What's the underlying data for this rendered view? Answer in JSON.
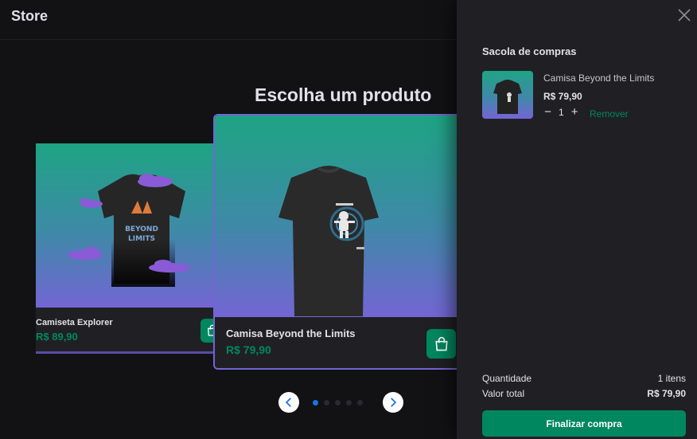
{
  "header": {
    "brand": "Store"
  },
  "main": {
    "title": "Escolha um produto"
  },
  "products": [
    {
      "name": "Camiseta Explorer",
      "price": "R$ 89,90"
    },
    {
      "name": "Camisa Beyond the Limits",
      "price": "R$ 79,90"
    }
  ],
  "carousel": {
    "dot_count": 5,
    "active_index": 0,
    "prev_icon": "chevron-left-icon",
    "next_icon": "chevron-right-icon"
  },
  "cart": {
    "title": "Sacola de compras",
    "item": {
      "name": "Camisa Beyond the Limits",
      "price": "R$ 79,90",
      "quantity": "1",
      "minus": "−",
      "plus": "+",
      "remove_label": "Remover"
    },
    "summary": {
      "qty_label": "Quantidade",
      "qty_value": "1 itens",
      "total_label": "Valor total",
      "total_value": "R$ 79,90"
    },
    "checkout_label": "Finalizar compra"
  },
  "colors": {
    "accent": "#00875f",
    "highlight": "#7465d4",
    "dot_active": "#1a73e8"
  }
}
